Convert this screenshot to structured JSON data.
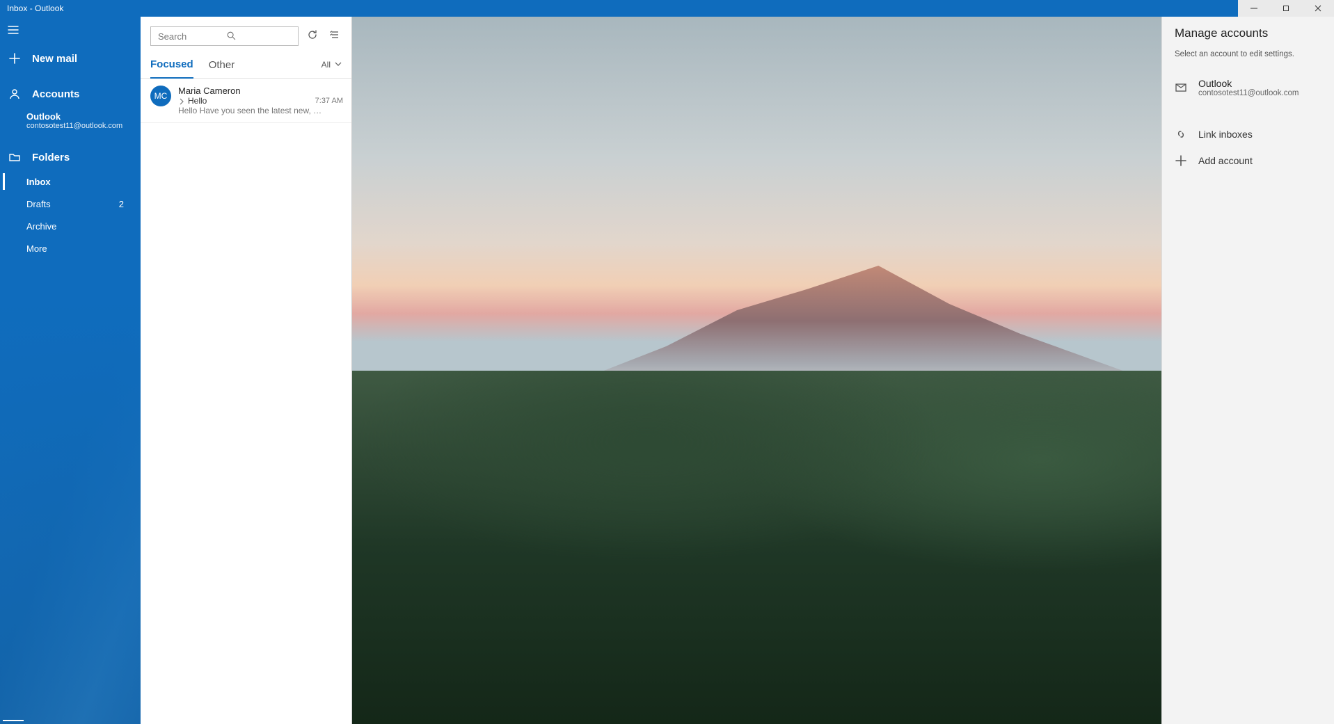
{
  "window": {
    "title": "Inbox - Outlook"
  },
  "sidebar": {
    "new_mail": "New mail",
    "accounts_label": "Accounts",
    "account": {
      "name": "Outlook",
      "email": "contosotest11@outlook.com"
    },
    "folders_label": "Folders",
    "folders": {
      "inbox": "Inbox",
      "drafts": "Drafts",
      "drafts_count": "2",
      "archive": "Archive",
      "more": "More"
    }
  },
  "messagelist": {
    "search_placeholder": "Search",
    "tabs": {
      "focused": "Focused",
      "other": "Other"
    },
    "filter": "All",
    "messages": [
      {
        "initials": "MC",
        "sender": "Maria Cameron",
        "subject": "Hello",
        "preview": "Hello Have you seen the latest new, …",
        "time": "7:37 AM"
      }
    ]
  },
  "rightpanel": {
    "title": "Manage accounts",
    "hint": "Select an account to edit settings.",
    "account": {
      "name": "Outlook",
      "email": "contosotest11@outlook.com"
    },
    "link_inboxes": "Link inboxes",
    "add_account": "Add account"
  }
}
